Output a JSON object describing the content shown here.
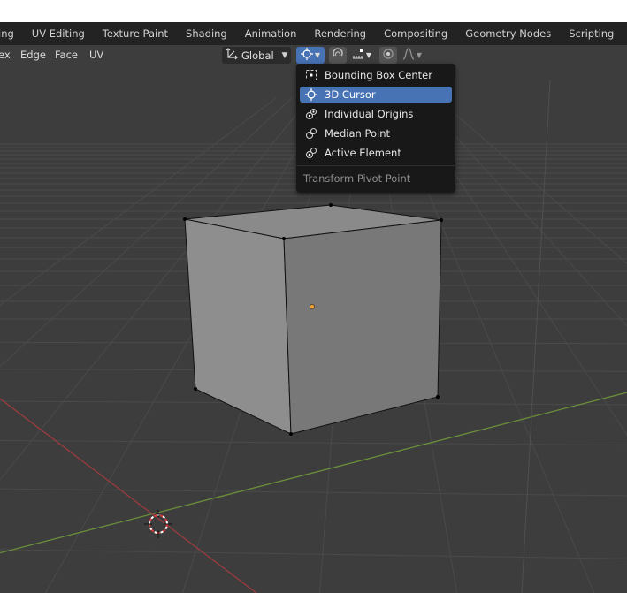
{
  "workspace_tabs": [
    {
      "label": "ing"
    },
    {
      "label": "UV Editing"
    },
    {
      "label": "Texture Paint"
    },
    {
      "label": "Shading"
    },
    {
      "label": "Animation"
    },
    {
      "label": "Rendering"
    },
    {
      "label": "Compositing"
    },
    {
      "label": "Geometry Nodes"
    },
    {
      "label": "Scripting"
    },
    {
      "label": "+"
    }
  ],
  "header": {
    "menus": [
      "ex",
      "Edge",
      "Face",
      "UV"
    ],
    "orientation": {
      "label": "Global",
      "icon": "transform-orientation-icon"
    },
    "pivot_icon": "pivot-3d-cursor-icon",
    "snap_icon": "magnet-icon",
    "proportional_icon": "proportional-edit-icon",
    "falloff_icon": "falloff-curve-icon"
  },
  "pivot_menu": {
    "items": [
      {
        "label": "Bounding Box Center",
        "icon": "bounding-box-center-icon",
        "active": false
      },
      {
        "label": "3D Cursor",
        "icon": "3d-cursor-icon",
        "active": true
      },
      {
        "label": "Individual Origins",
        "icon": "individual-origins-icon",
        "active": false
      },
      {
        "label": "Median Point",
        "icon": "median-point-icon",
        "active": false
      },
      {
        "label": "Active Element",
        "icon": "active-element-icon",
        "active": false
      }
    ],
    "title": "Transform Pivot Point"
  },
  "colors": {
    "accent": "#4772b3",
    "viewport_bg": "#3d3d3d",
    "x_axis": "#9b3b3f",
    "y_axis": "#6b8f3a",
    "origin": "#f0a030"
  }
}
